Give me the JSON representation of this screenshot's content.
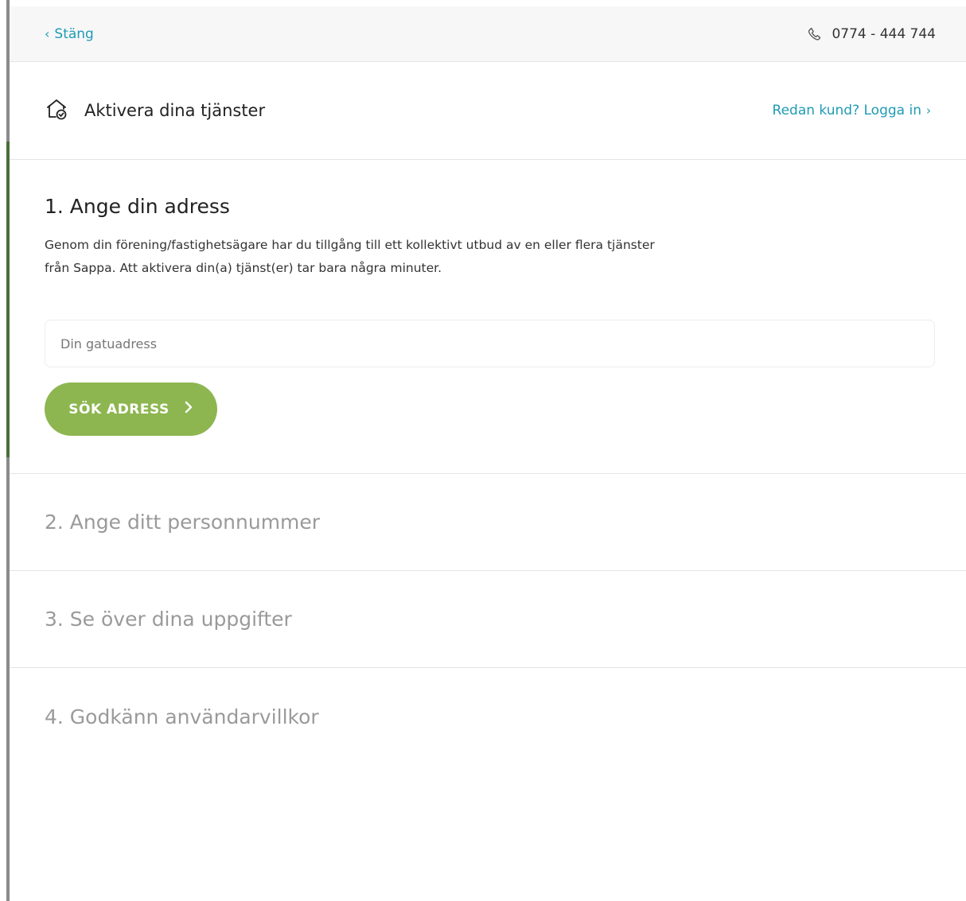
{
  "topbar": {
    "close_label": "Stäng",
    "phone_number": "0774 - 444 744"
  },
  "service": {
    "title": "Aktivera dina tjänster",
    "login_label": "Redan kund? Logga in"
  },
  "steps": [
    {
      "title": "1. Ange din adress",
      "description": "Genom din förening/fastighetsägare har du tillgång till ett kollektivt utbud av en eller flera tjänster från Sappa. Att aktivera din(a) tjänst(er) tar bara några minuter.",
      "input_placeholder": "Din gatuadress",
      "input_value": "",
      "button_label": "SÖK ADRESS"
    },
    {
      "title": "2. Ange ditt personnummer"
    },
    {
      "title": "3. Se över dina uppgifter"
    },
    {
      "title": "4. Godkänn användarvillkor"
    }
  ],
  "colors": {
    "accent_link": "#1f9bb5",
    "button_green": "#8db650",
    "inactive_text": "#9a9a9a"
  },
  "icons": {
    "close": "chevron-left-icon",
    "phone": "phone-icon",
    "service": "house-check-icon",
    "login": "chevron-right-icon",
    "button": "chevron-right-icon"
  }
}
